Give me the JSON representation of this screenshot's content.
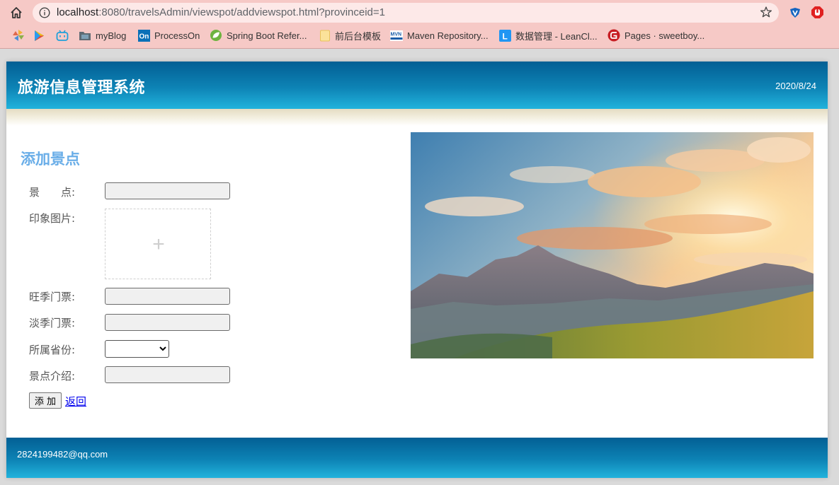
{
  "browser": {
    "url_host": "localhost",
    "url_rest": ":8080/travelsAdmin/viewspot/addviewspot.html?provinceid=1",
    "bookmarks": [
      {
        "label": "",
        "icon": "pinwheel-icon"
      },
      {
        "label": "",
        "icon": "play-store-icon"
      },
      {
        "label": "",
        "icon": "bilibili-icon"
      },
      {
        "label": "myBlog",
        "icon": "folder-icon"
      },
      {
        "label": "ProcessOn",
        "icon": "processon-icon"
      },
      {
        "label": "Spring Boot Refer...",
        "icon": "spring-icon"
      },
      {
        "label": "前后台模板",
        "icon": "folder-icon"
      },
      {
        "label": "Maven Repository...",
        "icon": "maven-icon"
      },
      {
        "label": "数据管理 - LeanCl...",
        "icon": "leancloud-icon"
      },
      {
        "label": "Pages · sweetboy...",
        "icon": "gitee-icon"
      }
    ]
  },
  "header": {
    "title": "旅游信息管理系统",
    "date": "2020/8/24"
  },
  "form": {
    "title": "添加景点",
    "spot_label": "景　　点:",
    "image_label": "印象图片:",
    "upload_plus": "+",
    "peak_price_label": "旺季门票:",
    "offpeak_price_label": "淡季门票:",
    "province_label": "所属省份:",
    "province_selected": "",
    "intro_label": "景点介绍:",
    "add_button": "添 加",
    "back_link": "返回"
  },
  "footer": {
    "email": "2824199482@qq.com"
  },
  "colors": {
    "header_dark": "#035f94",
    "header_light": "#21b3dc",
    "form_title": "#6aaee8",
    "link": "#0000ee"
  }
}
